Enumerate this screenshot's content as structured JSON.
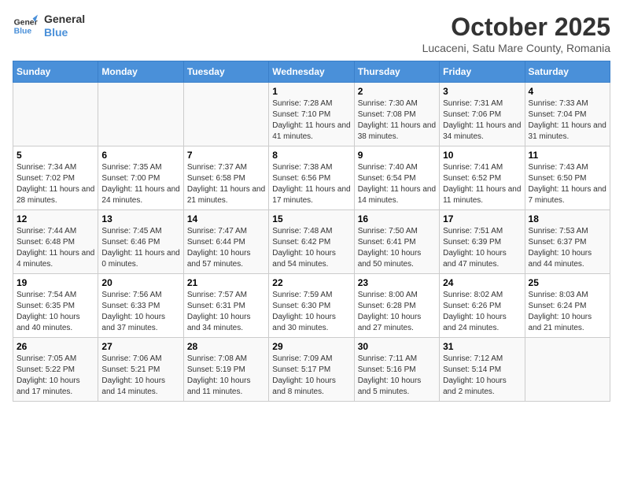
{
  "header": {
    "logo_line1": "General",
    "logo_line2": "Blue",
    "month": "October 2025",
    "location": "Lucaceni, Satu Mare County, Romania"
  },
  "weekdays": [
    "Sunday",
    "Monday",
    "Tuesday",
    "Wednesday",
    "Thursday",
    "Friday",
    "Saturday"
  ],
  "weeks": [
    [
      {
        "day": "",
        "info": ""
      },
      {
        "day": "",
        "info": ""
      },
      {
        "day": "",
        "info": ""
      },
      {
        "day": "1",
        "info": "Sunrise: 7:28 AM\nSunset: 7:10 PM\nDaylight: 11 hours and 41 minutes."
      },
      {
        "day": "2",
        "info": "Sunrise: 7:30 AM\nSunset: 7:08 PM\nDaylight: 11 hours and 38 minutes."
      },
      {
        "day": "3",
        "info": "Sunrise: 7:31 AM\nSunset: 7:06 PM\nDaylight: 11 hours and 34 minutes."
      },
      {
        "day": "4",
        "info": "Sunrise: 7:33 AM\nSunset: 7:04 PM\nDaylight: 11 hours and 31 minutes."
      }
    ],
    [
      {
        "day": "5",
        "info": "Sunrise: 7:34 AM\nSunset: 7:02 PM\nDaylight: 11 hours and 28 minutes."
      },
      {
        "day": "6",
        "info": "Sunrise: 7:35 AM\nSunset: 7:00 PM\nDaylight: 11 hours and 24 minutes."
      },
      {
        "day": "7",
        "info": "Sunrise: 7:37 AM\nSunset: 6:58 PM\nDaylight: 11 hours and 21 minutes."
      },
      {
        "day": "8",
        "info": "Sunrise: 7:38 AM\nSunset: 6:56 PM\nDaylight: 11 hours and 17 minutes."
      },
      {
        "day": "9",
        "info": "Sunrise: 7:40 AM\nSunset: 6:54 PM\nDaylight: 11 hours and 14 minutes."
      },
      {
        "day": "10",
        "info": "Sunrise: 7:41 AM\nSunset: 6:52 PM\nDaylight: 11 hours and 11 minutes."
      },
      {
        "day": "11",
        "info": "Sunrise: 7:43 AM\nSunset: 6:50 PM\nDaylight: 11 hours and 7 minutes."
      }
    ],
    [
      {
        "day": "12",
        "info": "Sunrise: 7:44 AM\nSunset: 6:48 PM\nDaylight: 11 hours and 4 minutes."
      },
      {
        "day": "13",
        "info": "Sunrise: 7:45 AM\nSunset: 6:46 PM\nDaylight: 11 hours and 0 minutes."
      },
      {
        "day": "14",
        "info": "Sunrise: 7:47 AM\nSunset: 6:44 PM\nDaylight: 10 hours and 57 minutes."
      },
      {
        "day": "15",
        "info": "Sunrise: 7:48 AM\nSunset: 6:42 PM\nDaylight: 10 hours and 54 minutes."
      },
      {
        "day": "16",
        "info": "Sunrise: 7:50 AM\nSunset: 6:41 PM\nDaylight: 10 hours and 50 minutes."
      },
      {
        "day": "17",
        "info": "Sunrise: 7:51 AM\nSunset: 6:39 PM\nDaylight: 10 hours and 47 minutes."
      },
      {
        "day": "18",
        "info": "Sunrise: 7:53 AM\nSunset: 6:37 PM\nDaylight: 10 hours and 44 minutes."
      }
    ],
    [
      {
        "day": "19",
        "info": "Sunrise: 7:54 AM\nSunset: 6:35 PM\nDaylight: 10 hours and 40 minutes."
      },
      {
        "day": "20",
        "info": "Sunrise: 7:56 AM\nSunset: 6:33 PM\nDaylight: 10 hours and 37 minutes."
      },
      {
        "day": "21",
        "info": "Sunrise: 7:57 AM\nSunset: 6:31 PM\nDaylight: 10 hours and 34 minutes."
      },
      {
        "day": "22",
        "info": "Sunrise: 7:59 AM\nSunset: 6:30 PM\nDaylight: 10 hours and 30 minutes."
      },
      {
        "day": "23",
        "info": "Sunrise: 8:00 AM\nSunset: 6:28 PM\nDaylight: 10 hours and 27 minutes."
      },
      {
        "day": "24",
        "info": "Sunrise: 8:02 AM\nSunset: 6:26 PM\nDaylight: 10 hours and 24 minutes."
      },
      {
        "day": "25",
        "info": "Sunrise: 8:03 AM\nSunset: 6:24 PM\nDaylight: 10 hours and 21 minutes."
      }
    ],
    [
      {
        "day": "26",
        "info": "Sunrise: 7:05 AM\nSunset: 5:22 PM\nDaylight: 10 hours and 17 minutes."
      },
      {
        "day": "27",
        "info": "Sunrise: 7:06 AM\nSunset: 5:21 PM\nDaylight: 10 hours and 14 minutes."
      },
      {
        "day": "28",
        "info": "Sunrise: 7:08 AM\nSunset: 5:19 PM\nDaylight: 10 hours and 11 minutes."
      },
      {
        "day": "29",
        "info": "Sunrise: 7:09 AM\nSunset: 5:17 PM\nDaylight: 10 hours and 8 minutes."
      },
      {
        "day": "30",
        "info": "Sunrise: 7:11 AM\nSunset: 5:16 PM\nDaylight: 10 hours and 5 minutes."
      },
      {
        "day": "31",
        "info": "Sunrise: 7:12 AM\nSunset: 5:14 PM\nDaylight: 10 hours and 2 minutes."
      },
      {
        "day": "",
        "info": ""
      }
    ]
  ]
}
